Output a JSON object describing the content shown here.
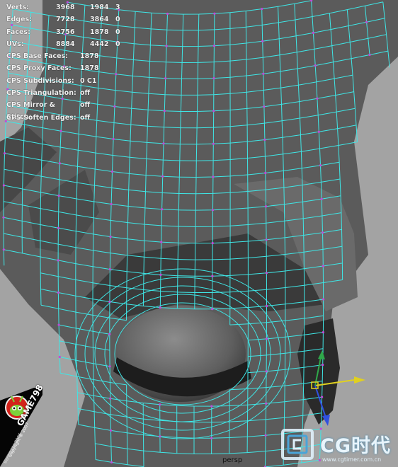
{
  "hud": {
    "verts": {
      "label": "Verts:",
      "a": "3968",
      "b": "1984",
      "c": "3"
    },
    "edges": {
      "label": "Edges:",
      "a": "7728",
      "b": "3864",
      "c": "0"
    },
    "faces": {
      "label": "Faces:",
      "a": "3756",
      "b": "1878",
      "c": "0"
    },
    "uvs": {
      "label": "UVs:",
      "a": "8884",
      "b": "4442",
      "c": "0"
    },
    "cps_base_faces": {
      "label": "CPS Base Faces:",
      "value": "1878"
    },
    "cps_proxy_faces": {
      "label": "CPS Proxy Faces:",
      "value": "1878"
    },
    "cps_subdivisions": {
      "label": "CPS Subdivisions:",
      "value": "0 C1"
    },
    "cps_triangulation": {
      "label": "CPS Triangulation:",
      "value": "off"
    },
    "cps_mirror_stitch": {
      "label": "CPS Mirror & Stitch:",
      "value": "off"
    },
    "cps_soften_edges": {
      "label": "CPS Soften Edges:",
      "value": "off"
    }
  },
  "viewport": {
    "camera_label": "persp",
    "mesh_face_color": "#5a5a5a",
    "wire_color": "#3fe6e6",
    "vertex_color": "#c04ad8"
  },
  "watermarks": {
    "game_brand": "GAME798",
    "game_copyright": "Copyright © 2007",
    "game_note": "Bango Ltd 2006",
    "cg_brand": "CG时代",
    "cg_url": "www.cgtimer.com.cn"
  },
  "icons": [
    "mascot-icon",
    "cg-logo-icon",
    "manipulator-icon"
  ]
}
